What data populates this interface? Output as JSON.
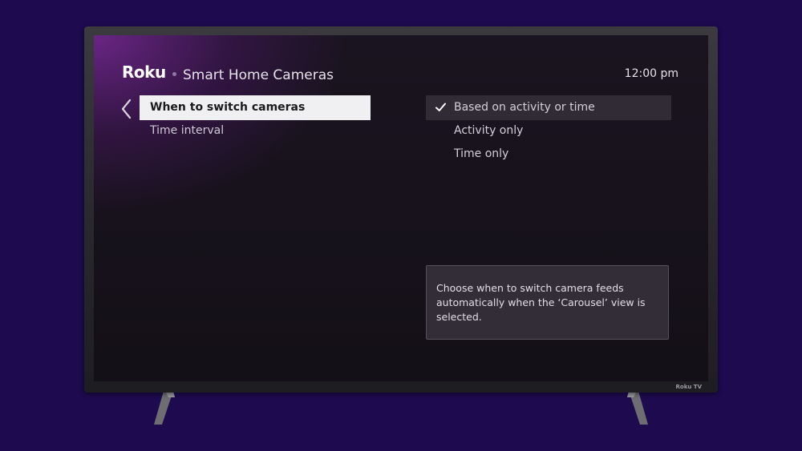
{
  "header": {
    "brand": "Roku",
    "title": "Smart Home Cameras",
    "clock": "12:00 pm"
  },
  "menu": {
    "items": [
      {
        "label": "When to switch cameras",
        "selected": true
      },
      {
        "label": "Time interval",
        "selected": false
      }
    ]
  },
  "options": {
    "items": [
      {
        "label": "Based on activity or time",
        "checked": true
      },
      {
        "label": "Activity only",
        "checked": false
      },
      {
        "label": "Time only",
        "checked": false
      }
    ]
  },
  "info": {
    "text": "Choose when to switch camera feeds automatically when the ‘Carousel’ view is selected."
  },
  "tv": {
    "badge": "Roku TV"
  },
  "colors": {
    "background": "#1d0a4f",
    "selection": "#f0eff2",
    "screen_glow": "#782896"
  },
  "icons": {
    "back": "chevron-left-icon",
    "check": "check-icon"
  }
}
